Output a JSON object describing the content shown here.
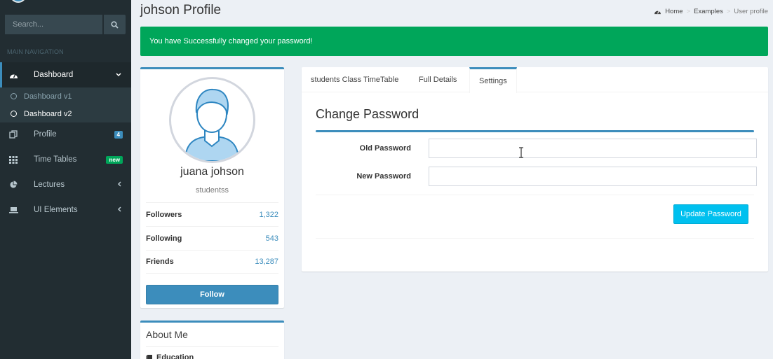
{
  "sidebar": {
    "search_placeholder": "Search...",
    "header": "MAIN NAVIGATION",
    "items": [
      {
        "label": "Dashboard",
        "icon": "dashboard-icon"
      },
      {
        "label": "Profile",
        "icon": "files-icon",
        "badge": "4",
        "badge_color": "#3c8dbc"
      },
      {
        "label": "Time Tables",
        "icon": "grid-icon",
        "badge": "new",
        "badge_color": "#00a65a"
      },
      {
        "label": "Lectures",
        "icon": "pie-chart-icon"
      },
      {
        "label": "UI Elements",
        "icon": "laptop-icon"
      }
    ],
    "subitems": [
      {
        "label": "Dashboard v1"
      },
      {
        "label": "Dashboard v2"
      }
    ]
  },
  "header": {
    "title": "johson Profile",
    "breadcrumb": [
      "Home",
      "Examples",
      "User profile"
    ]
  },
  "alert": {
    "message": "You have Successfully changed your password!",
    "color": "#00a65a"
  },
  "profile": {
    "name": "juana johson",
    "role": "studentss",
    "stats": [
      {
        "label": "Followers",
        "value": "1,322"
      },
      {
        "label": "Following",
        "value": "543"
      },
      {
        "label": "Friends",
        "value": "13,287"
      }
    ],
    "follow_label": "Follow"
  },
  "about": {
    "title": "About Me",
    "education_label": "Education"
  },
  "tabs": [
    {
      "label": "students Class TimeTable"
    },
    {
      "label": "Full Details"
    },
    {
      "label": "Settings",
      "active": true
    }
  ],
  "settings": {
    "title": "Change Password",
    "old_password_label": "Old Password",
    "old_password_value": "",
    "new_password_label": "New Password",
    "new_password_value": "",
    "submit_label": "Update Password"
  },
  "colors": {
    "accent": "#3c8dbc",
    "sidebar_bg": "#222d32",
    "success": "#00a65a",
    "info": "#00c0ef"
  }
}
